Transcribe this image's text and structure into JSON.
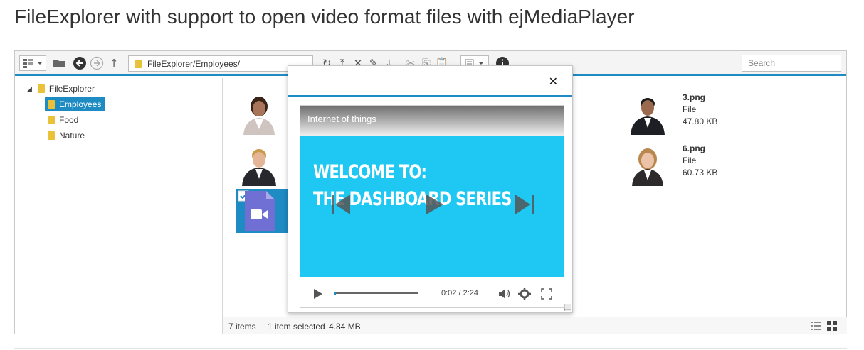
{
  "page": {
    "title": "FileExplorer with support to open video format files with ejMediaPlayer"
  },
  "toolbar": {
    "address_path": "FileExplorer/Employees/",
    "search_placeholder": "Search",
    "icons": [
      "layout-icon",
      "dropdown-icon",
      "new-folder-icon",
      "back-icon",
      "forward-icon",
      "up-icon",
      "refresh-icon",
      "upload-icon",
      "delete-icon",
      "rename-icon",
      "download-icon",
      "cut-icon",
      "copy-icon",
      "paste-icon",
      "view-icon",
      "details-icon"
    ]
  },
  "tree": {
    "root": "FileExplorer",
    "items": [
      "Employees",
      "Food",
      "Nature"
    ],
    "selected": "Employees"
  },
  "files": [
    {
      "name": "3.png",
      "type": "File",
      "size": "47.80 KB"
    },
    {
      "name": "6.png",
      "type": "File",
      "size": "60.73 KB"
    }
  ],
  "status": {
    "item_count": "7 items",
    "selection": "1 item selected",
    "selection_size": "4.84 MB"
  },
  "player": {
    "video_title": "Internet of things",
    "slide_line1": "WELCOME TO:",
    "slide_line2": "THE DASHBOARD SERIES",
    "time": "0:02 / 2:24",
    "progress": 0.014,
    "colors": {
      "accent": "#1e8bc3",
      "video_bg": "#1ec8f3"
    }
  }
}
